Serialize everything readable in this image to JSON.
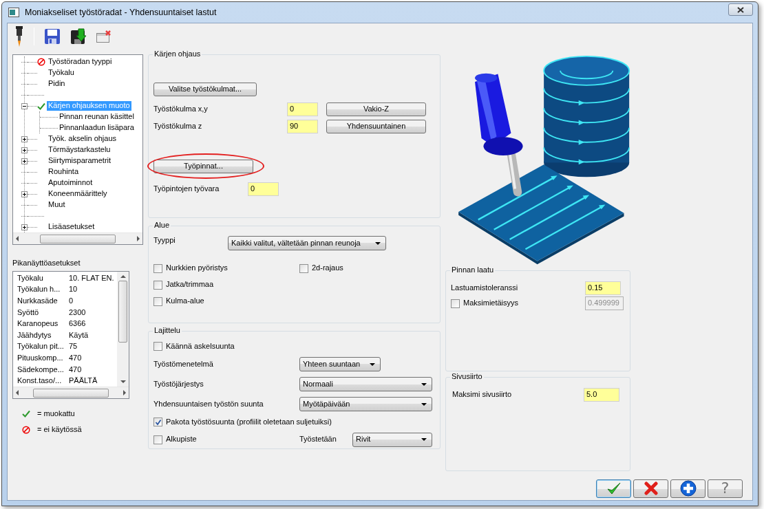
{
  "window": {
    "title": "Moniakseliset työstöradat - Yhdensuuntaiset lastut"
  },
  "toolbar": [
    {
      "kind": "tool"
    },
    {
      "kind": "save"
    },
    {
      "kind": "save_as"
    },
    {
      "kind": "discard"
    }
  ],
  "tree": {
    "items": [
      {
        "kind": "node",
        "label": "Työstöradan tyyppi",
        "disabled": true,
        "modified": false,
        "selected": false
      },
      {
        "kind": "node",
        "label": "Työkalu",
        "disabled": false,
        "modified": false,
        "selected": false
      },
      {
        "kind": "node",
        "label": "Pidin",
        "disabled": false,
        "modified": false,
        "selected": false
      },
      {
        "kind": "blank"
      },
      {
        "kind": "node",
        "label": "Kärjen ohjauksen muoto",
        "disabled": false,
        "modified": true,
        "selected": true,
        "expanded": true,
        "children": [
          {
            "kind": "node",
            "label": "Pinnan reunan käsittel",
            "selected": false
          },
          {
            "kind": "node",
            "label": "Pinnanlaadun lisäpara",
            "selected": false
          }
        ]
      },
      {
        "kind": "node",
        "label": "Työk. akselin ohjaus",
        "disabled": false,
        "modified": false,
        "selected": false,
        "expanded": false
      },
      {
        "kind": "node",
        "label": "Törmäystarkastelu",
        "disabled": false,
        "modified": false,
        "selected": false,
        "expanded": false
      },
      {
        "kind": "node",
        "label": "Siirtymisparametrit",
        "disabled": false,
        "modified": false,
        "selected": false,
        "expanded": false
      },
      {
        "kind": "node",
        "label": "Rouhinta",
        "disabled": false,
        "modified": false,
        "selected": false
      },
      {
        "kind": "node",
        "label": "Aputoiminnot",
        "disabled": false,
        "modified": false,
        "selected": false
      },
      {
        "kind": "node",
        "label": "Koneenmäärittely",
        "disabled": false,
        "modified": false,
        "selected": false,
        "expanded": false
      },
      {
        "kind": "node",
        "label": "Muut",
        "disabled": false,
        "modified": false,
        "selected": false
      },
      {
        "kind": "blank"
      },
      {
        "kind": "node",
        "label": "Lisäasetukset",
        "disabled": false,
        "modified": false,
        "selected": false,
        "expanded": false
      }
    ]
  },
  "quick_settings": {
    "title": "Pikanäyttöasetukset",
    "rows": [
      {
        "name": "Työkalu",
        "value": "10. FLAT EN."
      },
      {
        "name": "Työkalun h...",
        "value": "10"
      },
      {
        "name": "Nurkkasäde",
        "value": "0"
      },
      {
        "name": "Syöttö",
        "value": "2300"
      },
      {
        "name": "Karanopeus",
        "value": "6366"
      },
      {
        "name": "Jäähdytys",
        "value": "Käytä"
      },
      {
        "name": "Työkalun pit...",
        "value": "75"
      },
      {
        "name": "Pituuskomp...",
        "value": "470"
      },
      {
        "name": "Sädekompe...",
        "value": "470"
      },
      {
        "name": "Konst.taso/...",
        "value": "PÄÄLTÄ"
      }
    ]
  },
  "legend": [
    {
      "kind": "modified",
      "label": "= muokattu"
    },
    {
      "kind": "disabled",
      "label": "= ei käytössä"
    }
  ],
  "tool_direction": {
    "title": "Kärjen ohjaus",
    "angles_button": "Valitse työstökulmat...",
    "fields": [
      {
        "label": "Työstökulma x,y",
        "value": "0",
        "button": "Vakio-Z"
      },
      {
        "label": "Työstökulma z",
        "value": "90",
        "button": "Yhdensuuntainen"
      }
    ],
    "surfaces_button": {
      "label": "Työpinnat...",
      "highlighted": true
    },
    "stock": {
      "label": "Työpintojen työvara",
      "value": "0"
    }
  },
  "area": {
    "title": "Alue",
    "type": {
      "label": "Tyyppi",
      "value": "Kaikki valitut, vältetään pinnan reunoja"
    },
    "options_left": [
      {
        "label": "Nurkkien pyöristys",
        "checked": false
      },
      {
        "label": "Jatka/trimmaa",
        "checked": false
      },
      {
        "label": "Kulma-alue",
        "checked": false
      }
    ],
    "options_right": [
      {
        "label": "2d-rajaus",
        "checked": false
      }
    ]
  },
  "sorting": {
    "title": "Lajittelu",
    "rows": [
      {
        "kind": "checkbox",
        "label": "Käännä askelsuunta",
        "checked": false
      },
      {
        "kind": "select",
        "label": "Työstömenetelmä",
        "value": "Yhteen suuntaan"
      },
      {
        "kind": "select",
        "label": "Työstöjärjestys",
        "value": "Normaali"
      },
      {
        "kind": "select",
        "label": "Yhdensuuntaisen työstön suunta",
        "value": "Myötäpäivään"
      },
      {
        "kind": "checkbox",
        "label": "Pakota työstösuunta (profiilit oletetaan suljetuiksi)",
        "checked": true
      },
      {
        "kind": "checkbox_select",
        "label": "Alkupiste",
        "checked": false,
        "select_label": "Työstetään",
        "value": "Rivit"
      }
    ]
  },
  "surface_quality": {
    "title": "Pinnan laatu",
    "tolerance": {
      "label": "Lastuamistoleranssi",
      "value": "0.15"
    },
    "max_distance": {
      "label": "Maksimietäisyys",
      "checked": false,
      "value": "0.499999",
      "disabled": true
    }
  },
  "stepover": {
    "title": "Sivusiirto",
    "label": "Maksimi sivusiirto",
    "value": "5.0"
  },
  "dialog_buttons": [
    {
      "kind": "ok"
    },
    {
      "kind": "cancel"
    },
    {
      "kind": "add"
    },
    {
      "kind": "help",
      "label": "?"
    }
  ]
}
